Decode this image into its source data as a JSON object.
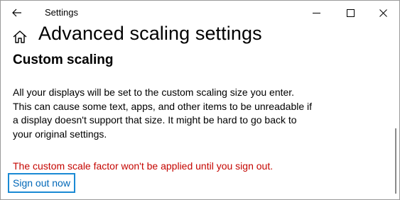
{
  "window": {
    "app_title": "Settings"
  },
  "page": {
    "title": "Advanced scaling settings",
    "section_title": "Custom scaling",
    "description_lines": [
      "All your displays will be set to the custom scaling size you enter.",
      "This can cause some text, apps, and other items to be unreadable if",
      "a display doesn't support that size. It might be hard to go back to",
      "your original settings."
    ],
    "warning": "The custom scale factor won't be applied until you sign out.",
    "sign_out_link": "Sign out now"
  },
  "icons": {
    "back": "back-arrow-icon",
    "home": "home-icon",
    "minimize": "minimize-icon",
    "maximize": "maximize-icon",
    "close": "close-icon"
  },
  "colors": {
    "warning": "#c50500",
    "link": "#0067b8",
    "focus_border": "#1a8ad4"
  }
}
